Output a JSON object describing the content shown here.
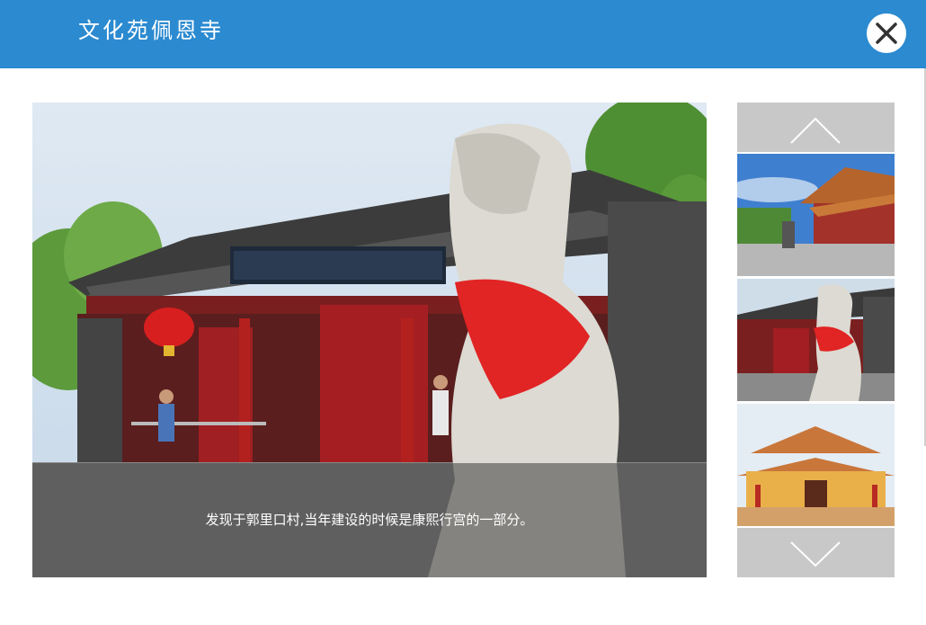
{
  "dialog": {
    "title": "文化苑佩恩寺",
    "close_icon": "close-icon"
  },
  "viewer": {
    "caption": "发现于郭里口村,当年建设的时候是康熙行宫的一部分。"
  },
  "thumbnails": {
    "up_icon": "chevron-up-icon",
    "down_icon": "chevron-down-icon",
    "items": [
      {
        "alt": "temple-hall-blue-sky"
      },
      {
        "alt": "stone-qilin-gate"
      },
      {
        "alt": "yellow-temple-hall"
      }
    ]
  },
  "colors": {
    "header": "#2b8ad0",
    "caption_overlay": "rgba(60,60,60,0.55)",
    "arrow_button": "#c8c8c8"
  }
}
